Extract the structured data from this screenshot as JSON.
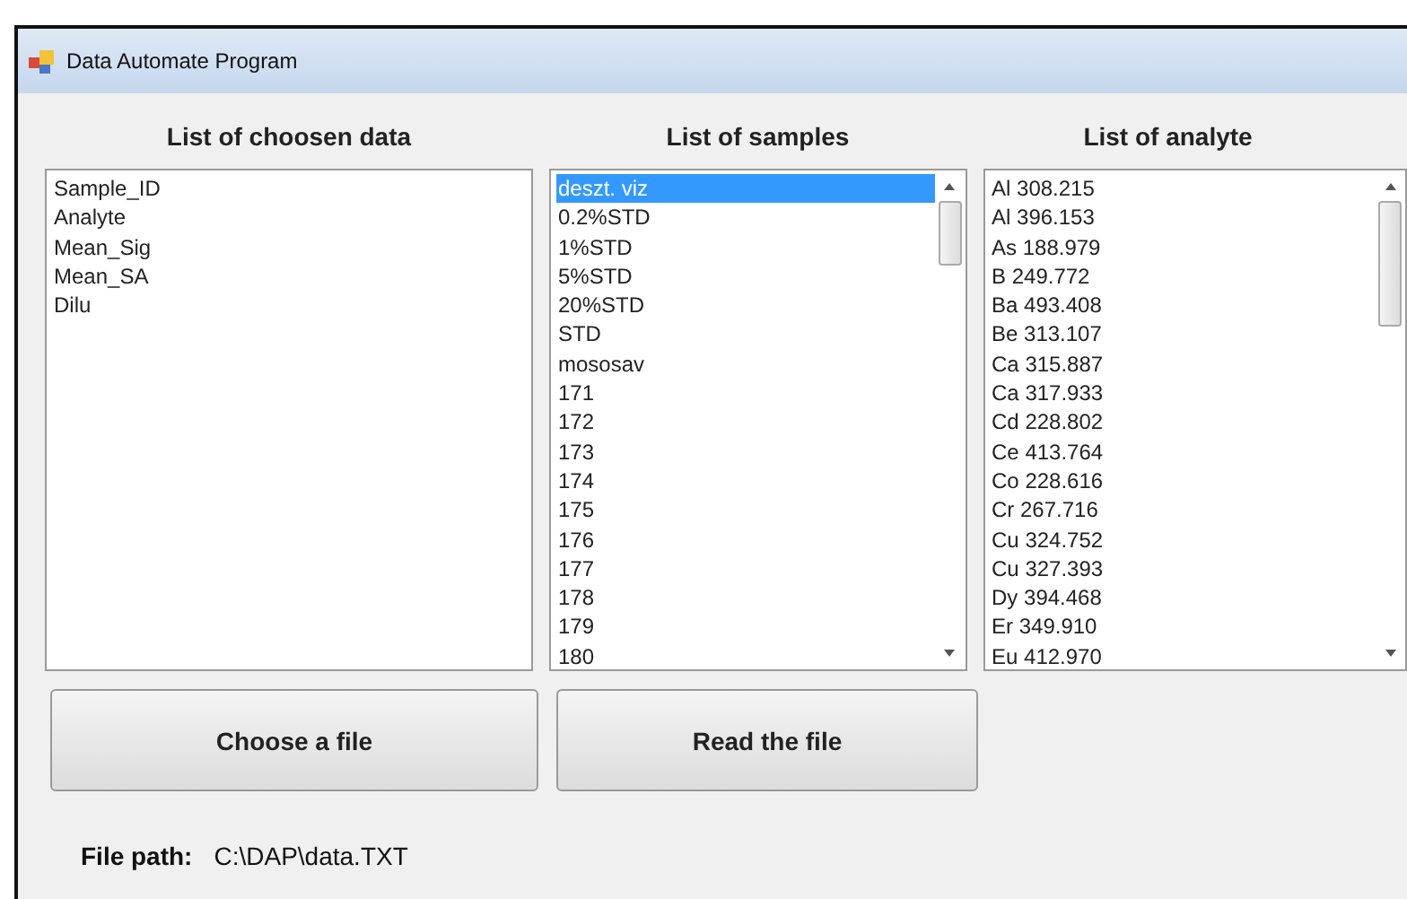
{
  "window": {
    "title": "Data Automate Program"
  },
  "chosen_data": {
    "heading": "List of choosen data",
    "items": [
      "Sample_ID",
      "Analyte",
      "Mean_Sig",
      "Mean_SA",
      "Dilu"
    ]
  },
  "samples": {
    "heading": "List of samples",
    "items": [
      {
        "label": "deszt. viz",
        "selected": true
      },
      {
        "label": "0.2%STD",
        "selected": false
      },
      {
        "label": "1%STD",
        "selected": false
      },
      {
        "label": "5%STD",
        "selected": false
      },
      {
        "label": "20%STD",
        "selected": false
      },
      {
        "label": "STD",
        "selected": false
      },
      {
        "label": "mososav",
        "selected": false
      },
      {
        "label": "171",
        "selected": false
      },
      {
        "label": "172",
        "selected": false
      },
      {
        "label": "173",
        "selected": false
      },
      {
        "label": "174",
        "selected": false
      },
      {
        "label": "175",
        "selected": false
      },
      {
        "label": "176",
        "selected": false
      },
      {
        "label": "177",
        "selected": false
      },
      {
        "label": "178",
        "selected": false
      },
      {
        "label": "179",
        "selected": false
      },
      {
        "label": "180",
        "selected": false
      }
    ]
  },
  "analytes": {
    "heading": "List of analyte",
    "items": [
      {
        "label": "Al 308.215",
        "selected": false
      },
      {
        "label": "Al 396.153",
        "selected": false
      },
      {
        "label": "As 188.979",
        "selected": false
      },
      {
        "label": "B 249.772",
        "selected": false
      },
      {
        "label": "Ba 493.408",
        "selected": false
      },
      {
        "label": "Be 313.107",
        "selected": false
      },
      {
        "label": "Ca 315.887",
        "selected": false
      },
      {
        "label": "Ca 317.933",
        "selected": false
      },
      {
        "label": "Cd 228.802",
        "selected": false
      },
      {
        "label": "Ce 413.764",
        "selected": false
      },
      {
        "label": "Co 228.616",
        "selected": false
      },
      {
        "label": "Cr 267.716",
        "selected": false
      },
      {
        "label": "Cu 324.752",
        "selected": false
      },
      {
        "label": "Cu 327.393",
        "selected": false
      },
      {
        "label": "Dy 394.468",
        "selected": false
      },
      {
        "label": "Er 349.910",
        "selected": false
      },
      {
        "label": "Eu 412.970",
        "selected": false
      }
    ]
  },
  "buttons": [
    "Choose a file",
    "Read the file"
  ],
  "file_path": {
    "label": "File path:",
    "value": "C:\\DAP\\data.TXT"
  }
}
